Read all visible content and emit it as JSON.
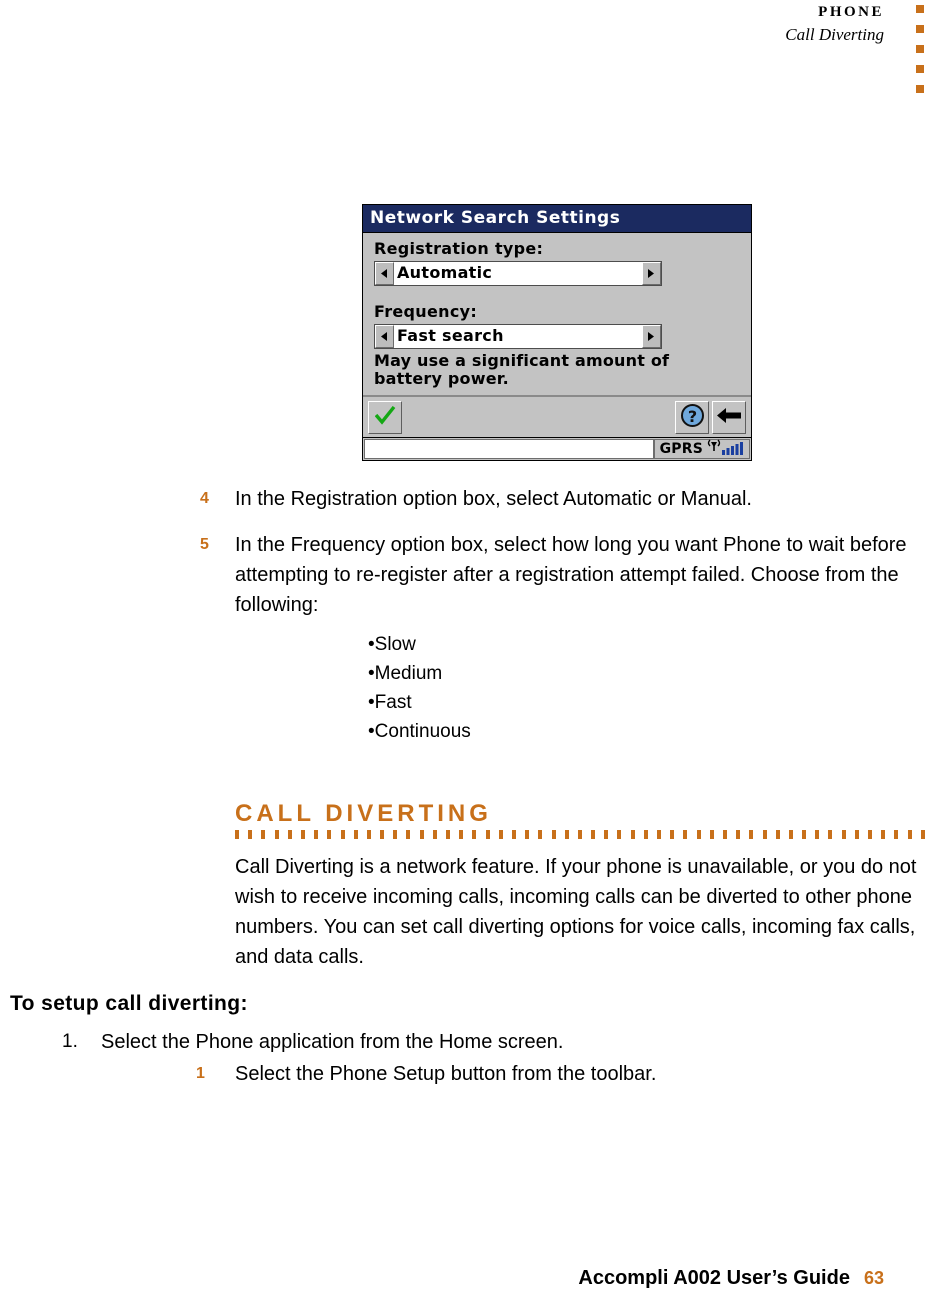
{
  "header": {
    "title": "PHONE",
    "subtitle": "Call Diverting",
    "corner_dot_count": 5,
    "accent_color": "#c8701a"
  },
  "device_screenshot": {
    "title": "Network Search Settings",
    "title_bar_color": "#1b2a60",
    "fields": [
      {
        "label": "Registration type:",
        "value": "Automatic"
      },
      {
        "label": "Frequency:",
        "value": "Fast search"
      }
    ],
    "hint": "May use a significant amount of battery power.",
    "toolbar": {
      "ok_icon": "check-icon",
      "help_icon": "question-mark-icon",
      "back_icon": "back-arrow-icon"
    },
    "status_bar": {
      "text": "GPRS",
      "signal_icon": "antenna-signal-icon",
      "bars": 5
    }
  },
  "steps": [
    {
      "number": "4",
      "text": "In the Registration option box, select Automatic or Manual."
    },
    {
      "number": "5",
      "text": "In the Frequency option box, select how long you want Phone to wait before attempting to re-register after a registration attempt failed. Choose from the following:"
    }
  ],
  "bullet_list": [
    "•Slow",
    "•Medium",
    "•Fast",
    "•Continuous"
  ],
  "section": {
    "heading": "CALL DIVERTING",
    "rule_dot_count": 53,
    "body": "Call Diverting is a network feature. If your phone is unavailable, or you do not wish to receive incoming calls, incoming calls can be diverted to other phone numbers. You can set call diverting options for voice calls, incoming fax calls, and data calls."
  },
  "procedure": {
    "heading": "To setup call diverting:",
    "items": [
      {
        "marker": "1.",
        "text": "Select the Phone application from the Home screen."
      },
      {
        "marker": "1",
        "text": "Select the Phone Setup button from the toolbar."
      }
    ]
  },
  "footer": {
    "text": "Accompli A002 User’s Guide",
    "page_number": "63"
  }
}
